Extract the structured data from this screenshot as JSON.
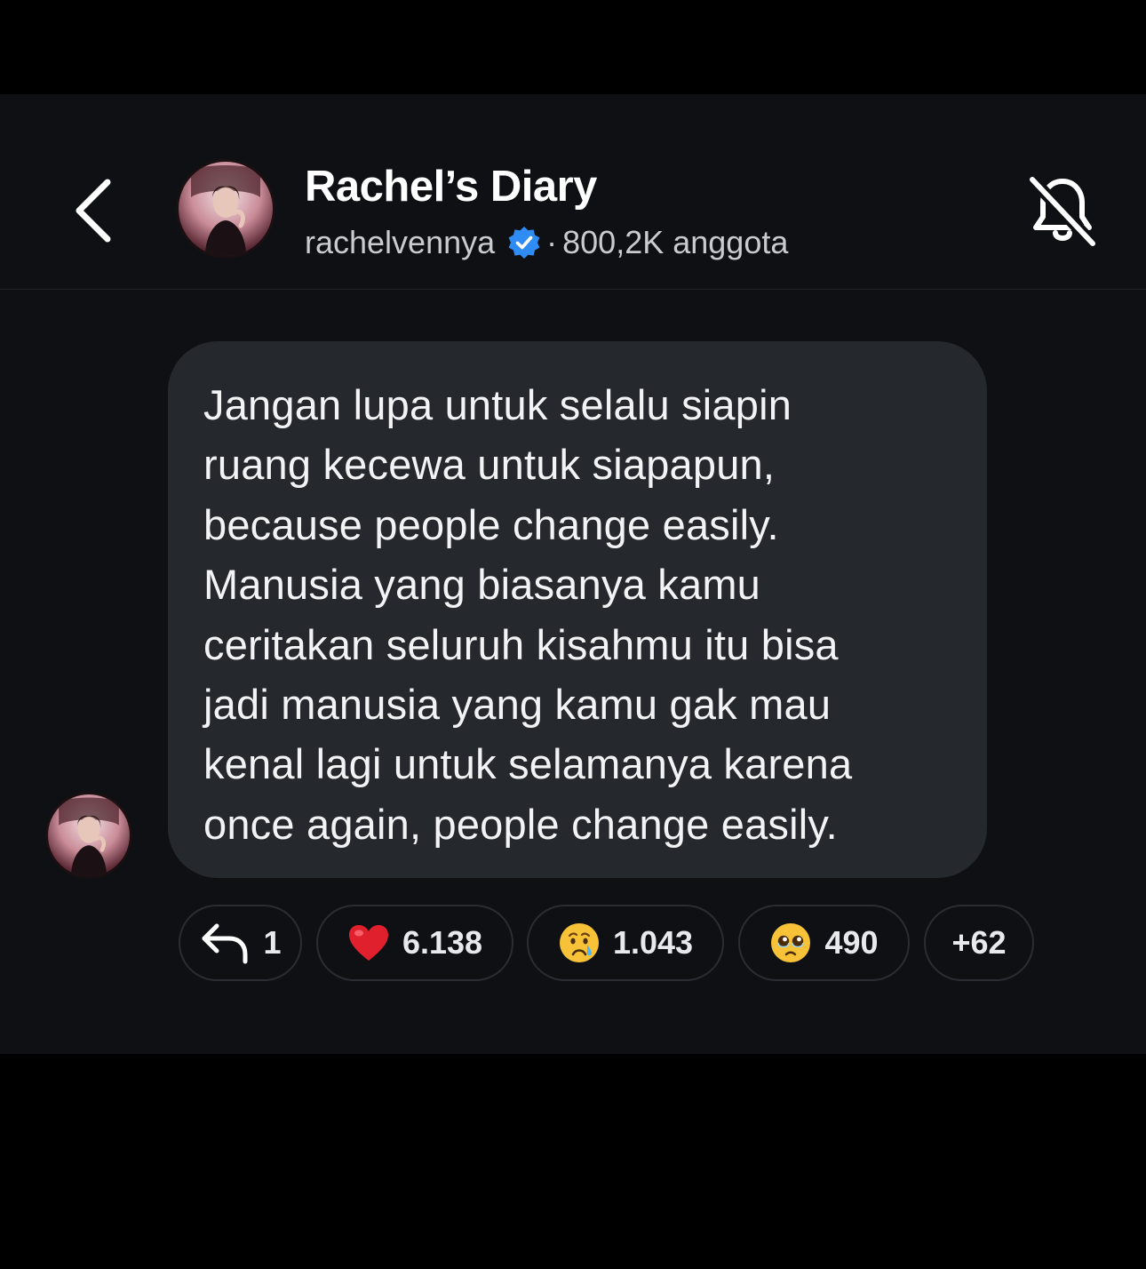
{
  "header": {
    "title": "Rachel’s Diary",
    "username": "rachelvennya",
    "separator": "·",
    "members": "800,2K anggota"
  },
  "message": {
    "lines": [
      "Jangan lupa untuk selalu siapin",
      "ruang kecewa untuk siapapun,",
      "because people change easily.",
      "Manusia yang biasanya kamu",
      "ceritakan seluruh kisahmu itu bisa",
      "jadi manusia yang kamu gak mau",
      "kenal lagi untuk selamanya karena",
      "once again, people change easily."
    ]
  },
  "reactions": {
    "reply_count": "1",
    "heart_count": "6.138",
    "cry_count": "1.043",
    "pleading_count": "490",
    "more_count": "+62"
  },
  "icons": {
    "back": "chevron-left-icon",
    "bell": "bell-off-icon",
    "verified": "verified-badge-icon",
    "reply": "reply-arrow-icon",
    "heart": "red-heart-emoji",
    "cry": "crying-face-emoji",
    "pleading": "pleading-face-emoji"
  },
  "colors": {
    "background": "#0e1014",
    "bubble": "#25282d",
    "verified": "#2f8cf4",
    "heart": "#e0212d"
  }
}
